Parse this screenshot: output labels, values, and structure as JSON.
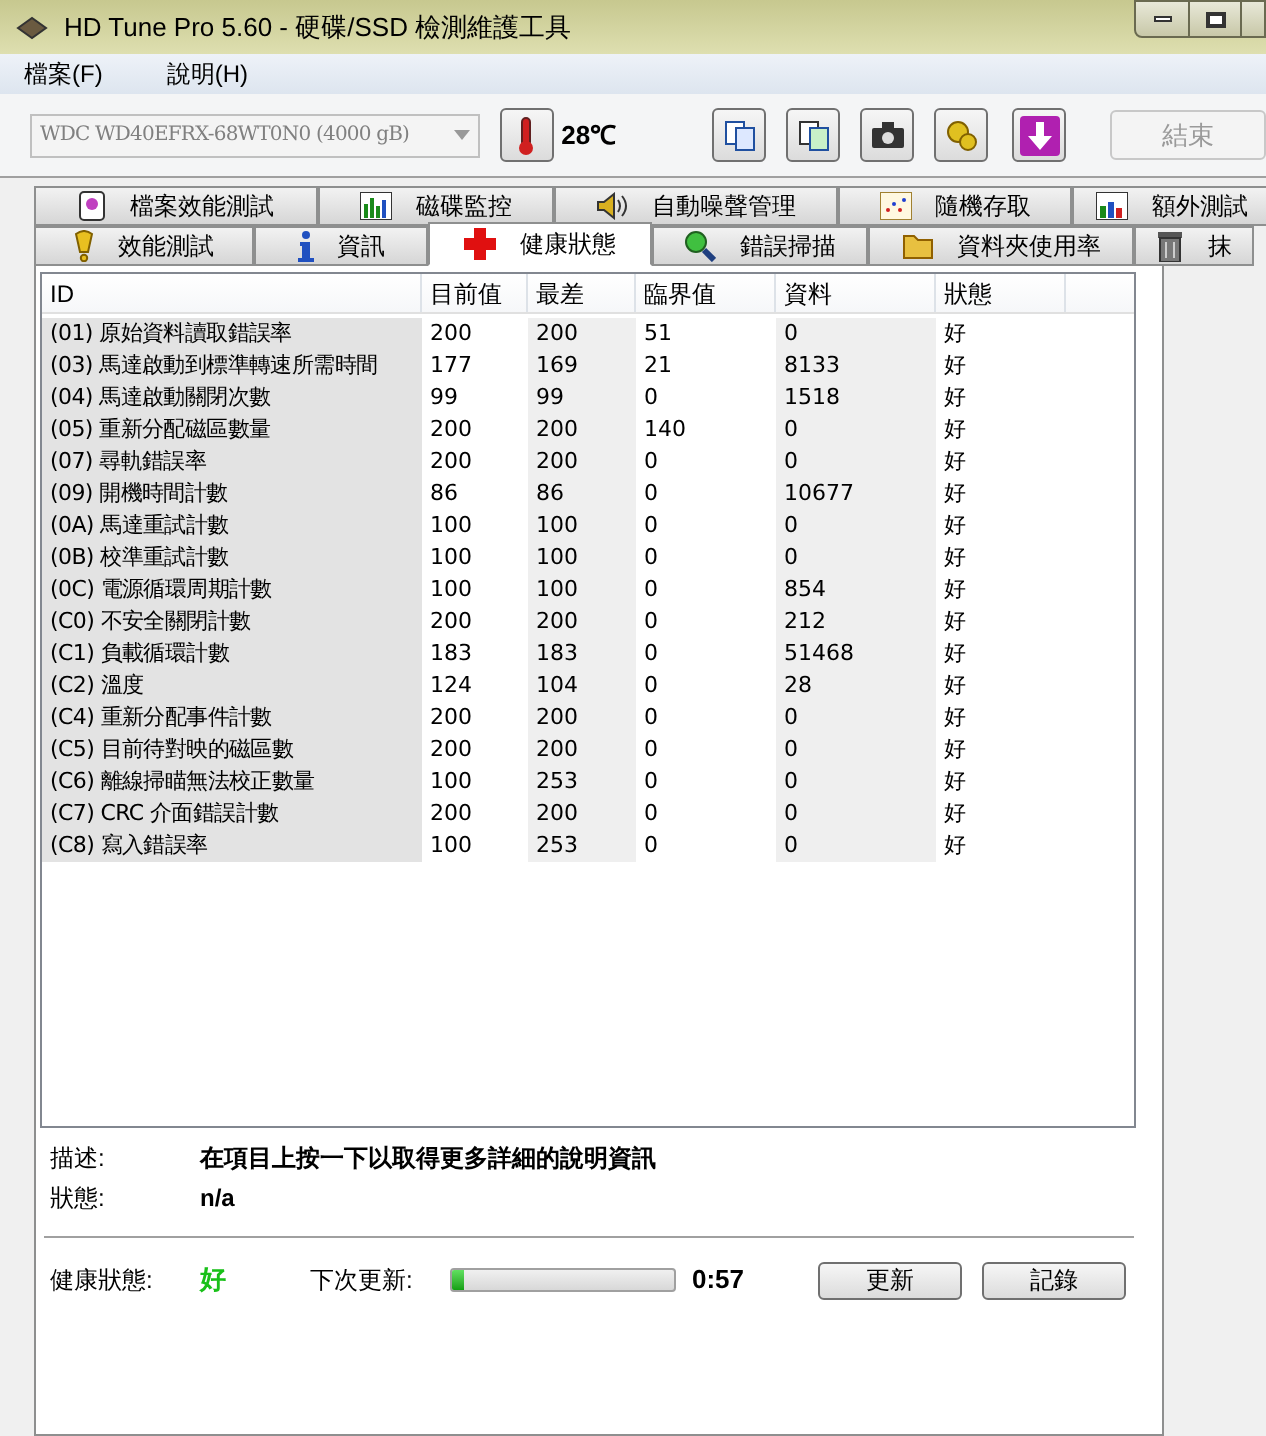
{
  "window": {
    "title": "HD Tune Pro 5.60 - 硬碟/SSD 檢測維護工具"
  },
  "menu": [
    "檔案(F)",
    "說明(H)"
  ],
  "toolbar": {
    "drive": "WDC WD40EFRX-68WT0N0 (4000 gB)",
    "temperature": "28℃",
    "exit_button": {
      "label": "結束",
      "disabled": true
    }
  },
  "tabs_row_1": [
    {
      "label": "檔案效能測試",
      "selected": false
    },
    {
      "label": "磁碟監控",
      "selected": false
    },
    {
      "label": "自動噪聲管理",
      "selected": false
    },
    {
      "label": "隨機存取",
      "selected": false
    },
    {
      "label": "額外測試",
      "selected": false
    }
  ],
  "tabs_row_2": [
    {
      "label": "效能測試",
      "selected": false
    },
    {
      "label": "資訊",
      "selected": false
    },
    {
      "label": "健康狀態",
      "selected": true
    },
    {
      "label": "錯誤掃描",
      "selected": false
    },
    {
      "label": "資料夾使用率",
      "selected": false
    },
    {
      "label": "抹",
      "selected": false
    }
  ],
  "table": {
    "columns": [
      "ID",
      "目前值",
      "最差",
      "臨界值",
      "資料",
      "狀態"
    ],
    "rows": [
      [
        "(01) 原始資料讀取錯誤率",
        "200",
        "200",
        "51",
        "0",
        "好"
      ],
      [
        "(03) 馬達啟動到標準轉速所需時間",
        "177",
        "169",
        "21",
        "8133",
        "好"
      ],
      [
        "(04) 馬達啟動關閉次數",
        "99",
        "99",
        "0",
        "1518",
        "好"
      ],
      [
        "(05) 重新分配磁區數量",
        "200",
        "200",
        "140",
        "0",
        "好"
      ],
      [
        "(07) 尋軌錯誤率",
        "200",
        "200",
        "0",
        "0",
        "好"
      ],
      [
        "(09) 開機時間計數",
        "86",
        "86",
        "0",
        "10677",
        "好"
      ],
      [
        "(0A) 馬達重試計數",
        "100",
        "100",
        "0",
        "0",
        "好"
      ],
      [
        "(0B) 校準重試計數",
        "100",
        "100",
        "0",
        "0",
        "好"
      ],
      [
        "(0C) 電源循環周期計數",
        "100",
        "100",
        "0",
        "854",
        "好"
      ],
      [
        "(C0) 不安全關閉計數",
        "200",
        "200",
        "0",
        "212",
        "好"
      ],
      [
        "(C1) 負載循環計數",
        "183",
        "183",
        "0",
        "51468",
        "好"
      ],
      [
        "(C2) 溫度",
        "124",
        "104",
        "0",
        "28",
        "好"
      ],
      [
        "(C4) 重新分配事件計數",
        "200",
        "200",
        "0",
        "0",
        "好"
      ],
      [
        "(C5) 目前待對映的磁區數",
        "200",
        "200",
        "0",
        "0",
        "好"
      ],
      [
        "(C6) 離線掃瞄無法校正數量",
        "100",
        "253",
        "0",
        "0",
        "好"
      ],
      [
        "(C7) CRC 介面錯誤計數",
        "200",
        "200",
        "0",
        "0",
        "好"
      ],
      [
        "(C8) 寫入錯誤率",
        "100",
        "253",
        "0",
        "0",
        "好"
      ]
    ]
  },
  "details": {
    "description_label": "描述:",
    "description": "在項目上按一下以取得更多詳細的說明資訊",
    "status_label": "狀態:",
    "status": "n/a"
  },
  "footer": {
    "health_label": "健康狀態:",
    "health": "好",
    "next_update_label": "下次更新:",
    "level": 0.05,
    "countdown": "0:57",
    "buttons": [
      "更新",
      "記錄"
    ]
  }
}
